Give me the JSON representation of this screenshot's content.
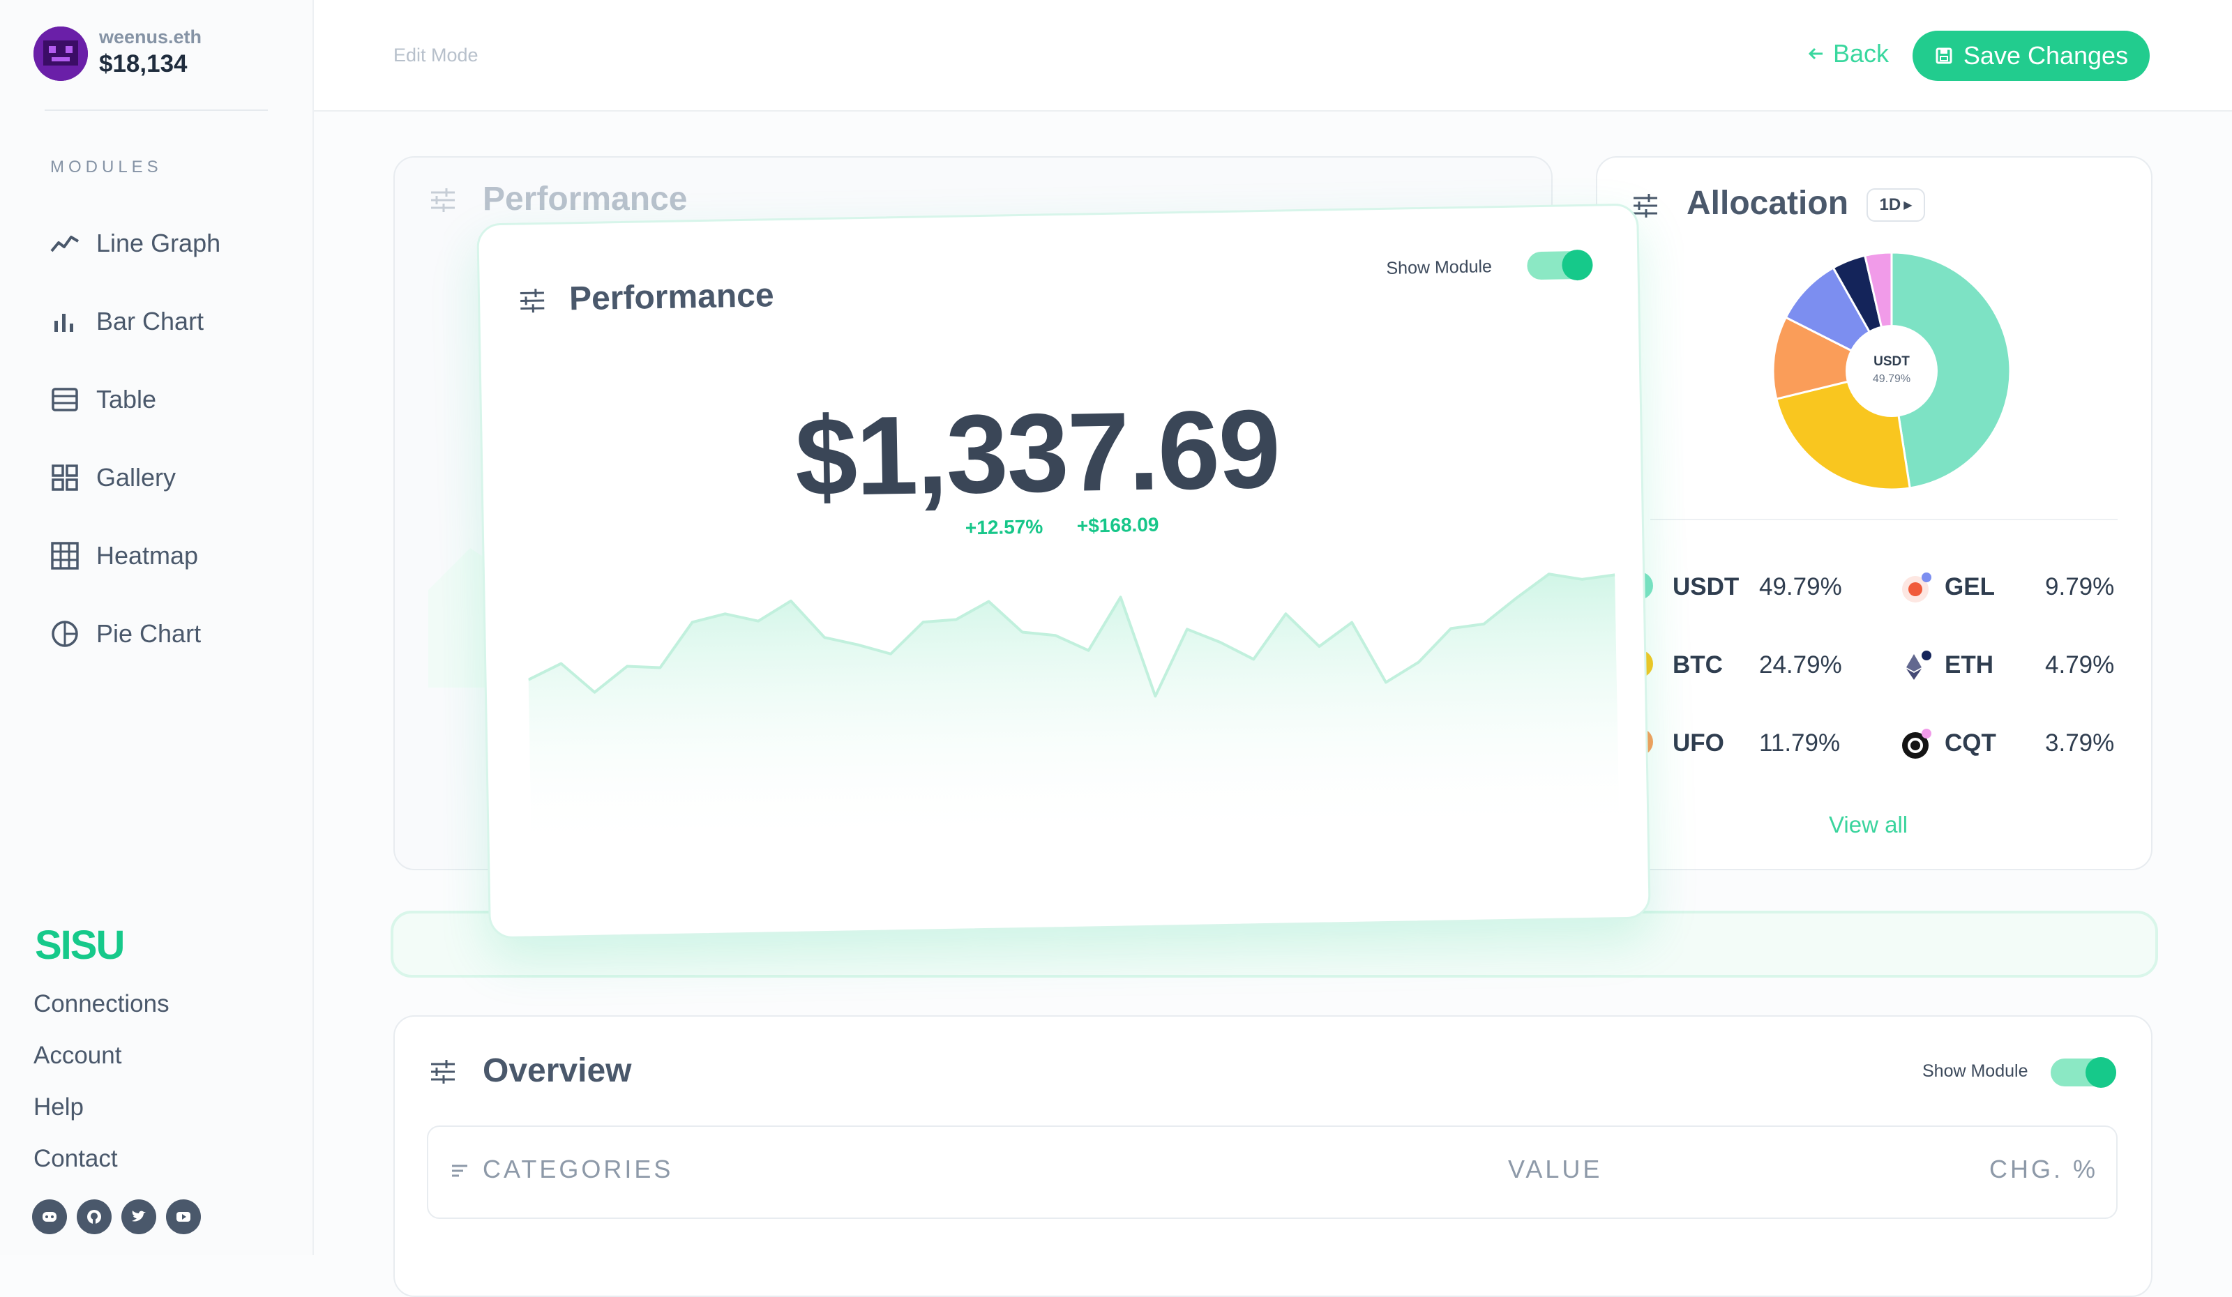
{
  "user": {
    "name": "weenus.eth",
    "balance": "$18,134"
  },
  "sidebar": {
    "modules_title": "MODULES",
    "items": [
      {
        "label": "Line Graph",
        "icon": "line-graph-icon"
      },
      {
        "label": "Bar Chart",
        "icon": "bar-chart-icon"
      },
      {
        "label": "Table",
        "icon": "table-icon"
      },
      {
        "label": "Gallery",
        "icon": "gallery-icon"
      },
      {
        "label": "Heatmap",
        "icon": "heatmap-icon"
      },
      {
        "label": "Pie Chart",
        "icon": "pie-chart-icon"
      }
    ],
    "brand": "SISU",
    "links": [
      "Connections",
      "Account",
      "Help",
      "Contact"
    ],
    "socials": [
      "discord-icon",
      "github-icon",
      "twitter-icon",
      "youtube-icon"
    ]
  },
  "header": {
    "mode": "Edit Mode",
    "back": "Back",
    "save": "Save Changes"
  },
  "performance": {
    "title": "Performance",
    "show_module": "Show Module",
    "toggle_on": true,
    "value": "$1,337.69",
    "change_pct": "+12.57%",
    "change_abs": "+$168.09"
  },
  "allocation": {
    "title": "Allocation",
    "range": "1D",
    "center_label": "USDT",
    "center_value": "49.79%",
    "view_all": "View all",
    "assets": [
      {
        "symbol": "USDT",
        "pct": "49.79%",
        "share": 49.79,
        "color": "#7de2c4"
      },
      {
        "symbol": "BTC",
        "pct": "24.79%",
        "share": 24.79,
        "color": "#f9c61f"
      },
      {
        "symbol": "UFO",
        "pct": "11.79%",
        "share": 11.79,
        "color": "#fa9d59"
      },
      {
        "symbol": "GEL",
        "pct": "9.79%",
        "share": 9.79,
        "color": "#7c8ef0"
      },
      {
        "symbol": "ETH",
        "pct": "4.79%",
        "share": 4.79,
        "color": "#14245a"
      },
      {
        "symbol": "CQT",
        "pct": "3.79%",
        "share": 3.79,
        "color": "#f19be9"
      }
    ]
  },
  "overview": {
    "title": "Overview",
    "show_module": "Show Module",
    "columns": [
      "CATEGORIES",
      "VALUE",
      "CHG. %"
    ]
  },
  "chart_data": {
    "type": "area",
    "values": [
      42,
      50,
      35,
      48,
      47,
      70,
      74,
      70,
      80,
      61,
      57,
      52,
      68,
      69,
      78,
      62,
      60,
      52,
      79,
      28,
      62,
      55,
      46,
      69,
      52,
      64,
      33,
      43,
      60,
      62,
      75,
      87,
      84,
      86
    ]
  }
}
